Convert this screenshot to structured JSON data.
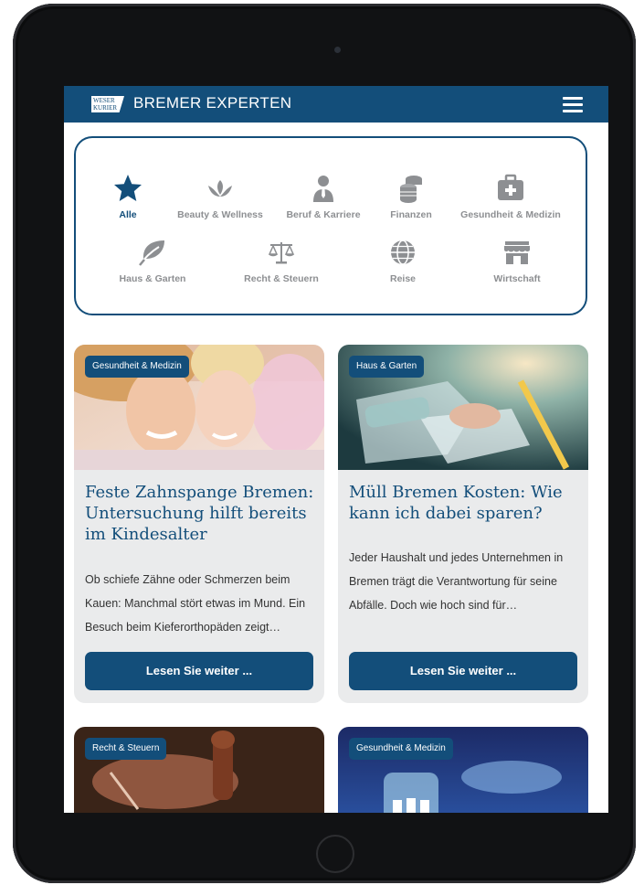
{
  "header": {
    "logo_line1": "WESER",
    "logo_line2": "KURIER",
    "brand": "BREMER EXPERTEN",
    "menu_icon": "hamburger-menu-icon"
  },
  "categories": [
    {
      "label": "Alle",
      "icon": "star-icon",
      "active": true
    },
    {
      "label": "Beauty & Wellness",
      "icon": "lotus-icon"
    },
    {
      "label": "Beruf & Karriere",
      "icon": "businessman-icon"
    },
    {
      "label": "Finanzen",
      "icon": "coins-icon"
    },
    {
      "label": "Gesundheit & Medizin",
      "icon": "first-aid-kit-icon"
    },
    {
      "label": "Haus & Garten",
      "icon": "leaf-icon"
    },
    {
      "label": "Recht & Steuern",
      "icon": "scales-icon"
    },
    {
      "label": "Reise",
      "icon": "globe-icon"
    },
    {
      "label": "Wirtschaft",
      "icon": "store-icon"
    }
  ],
  "cards": [
    {
      "badge": "Gesundheit & Medizin",
      "title": "Feste Zahnspange Bremen: Untersuchung hilft bereits im Kindesalter",
      "excerpt": "Ob schiefe Zähne oder Schmerzen beim Kauen: Manchmal stört etwas im Mund. Ein Besuch beim Kieferorthopäden zeigt…",
      "button": "Lesen Sie weiter ..."
    },
    {
      "badge": "Haus & Garten",
      "title": "Müll Bremen Kosten: Wie kann ich dabei sparen?",
      "excerpt": "Jeder Haushalt und jedes Unternehmen in Bremen trägt die Verantwortung für seine Abfälle. Doch wie hoch sind für…",
      "button": "Lesen Sie weiter ..."
    },
    {
      "badge": "Recht & Steuern"
    },
    {
      "badge": "Gesundheit & Medizin"
    }
  ],
  "colors": {
    "brand": "#134e7a",
    "card_bg": "#eaebec",
    "inactive": "#8d8f92"
  }
}
